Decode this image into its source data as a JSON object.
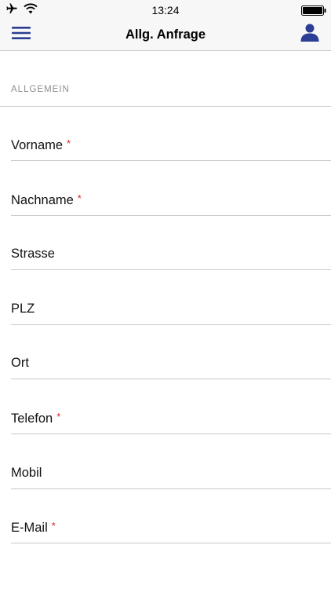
{
  "status_bar": {
    "time": "13:24",
    "left_icons": [
      "airplane-icon",
      "wifi-icon"
    ],
    "right_icons": [
      "battery-icon"
    ]
  },
  "nav": {
    "title": "Allg. Anfrage",
    "menu_icon": "hamburger-menu-icon",
    "profile_icon": "user-profile-icon",
    "accent_color": "#2b3d94"
  },
  "section": {
    "header": "ALLGEMEIN"
  },
  "form": {
    "required_marker": "*",
    "required_color": "#e02020",
    "fields": [
      {
        "label": "Vorname",
        "required": true
      },
      {
        "label": "Nachname",
        "required": true
      },
      {
        "label": "Strasse",
        "required": false
      },
      {
        "label": "PLZ",
        "required": false
      },
      {
        "label": "Ort",
        "required": false
      },
      {
        "label": "Telefon",
        "required": true
      },
      {
        "label": "Mobil",
        "required": false
      },
      {
        "label": "E-Mail",
        "required": true
      }
    ]
  }
}
